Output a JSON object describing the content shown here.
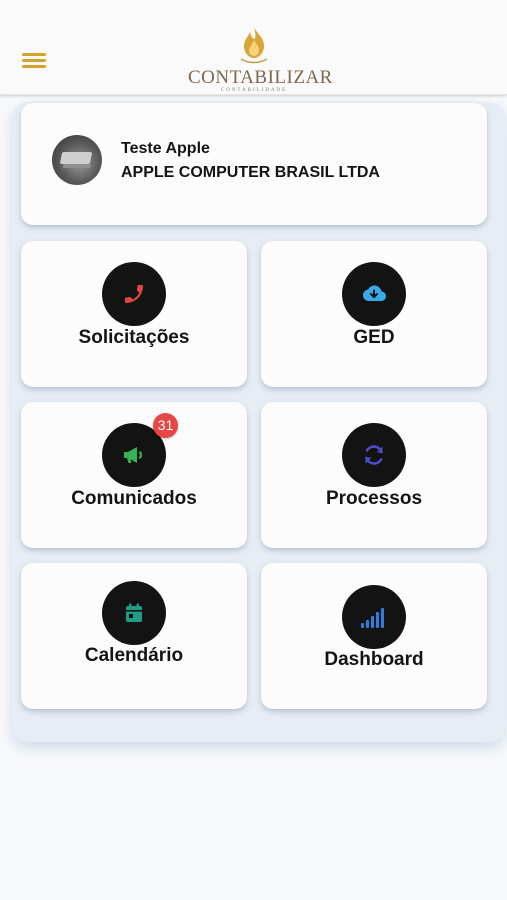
{
  "header": {
    "brand_name": "CONTABILIZAR",
    "brand_subtitle": "CONTABILIDADE",
    "menu_icon": "hamburger-icon",
    "accent_color": "#d4a22a"
  },
  "profile": {
    "name": "Teste Apple",
    "company": "APPLE COMPUTER BRASIL LTDA"
  },
  "tiles": [
    {
      "label": "Solicitações",
      "icon": "phone-icon",
      "icon_color": "#e2463f"
    },
    {
      "label": "GED",
      "icon": "cloud-download-icon",
      "icon_color": "#3aa9e8"
    },
    {
      "label": "Comunicados",
      "icon": "megaphone-icon",
      "icon_color": "#36b15a",
      "badge": "31"
    },
    {
      "label": "Processos",
      "icon": "sync-icon",
      "icon_color": "#4a4fc9"
    },
    {
      "label": "Calendário",
      "icon": "calendar-icon",
      "icon_color": "#1e9e86"
    },
    {
      "label": "Dashboard",
      "icon": "signal-bars-icon",
      "icon_color": "#2f7fde"
    }
  ]
}
